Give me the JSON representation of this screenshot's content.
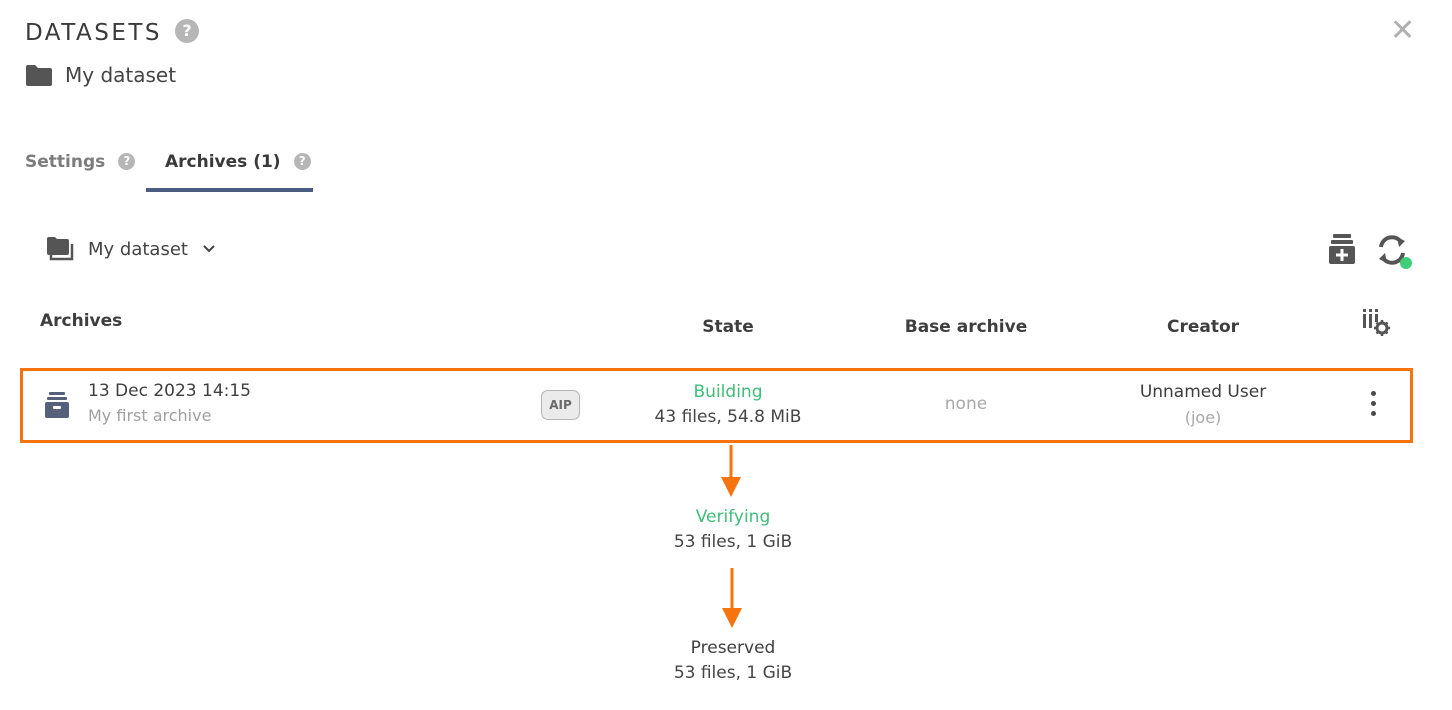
{
  "header": {
    "title": "DATASETS",
    "help_label": "?",
    "close_label": "✕"
  },
  "breadcrumb": {
    "dataset_name": "My dataset"
  },
  "tabs": [
    {
      "label": "Settings",
      "help_label": "?",
      "active": false
    },
    {
      "label": "Archives (1)",
      "help_label": "?",
      "active": true
    }
  ],
  "dataset_selector": {
    "label": "My dataset"
  },
  "table": {
    "headers": {
      "archives": "Archives",
      "state": "State",
      "base_archive": "Base archive",
      "creator": "Creator"
    },
    "rows": [
      {
        "date": "13 Dec 2023 14:15",
        "description": "My first archive",
        "badge": "AIP",
        "state": "Building",
        "stats": "43 files, 54.8 MiB",
        "base_archive": "none",
        "creator_name": "Unnamed User",
        "creator_login": "(joe)"
      }
    ]
  },
  "annotations": {
    "step2_state": "Verifying",
    "step2_stats": "53 files, 1 GiB",
    "step3_state": "Preserved",
    "step3_stats": "53 files, 1 GiB"
  },
  "colors": {
    "accent": "#f7730e",
    "state_green": "#3fbd78",
    "tab_underline": "#4b5d80",
    "status_dot": "#3ecf7b"
  }
}
